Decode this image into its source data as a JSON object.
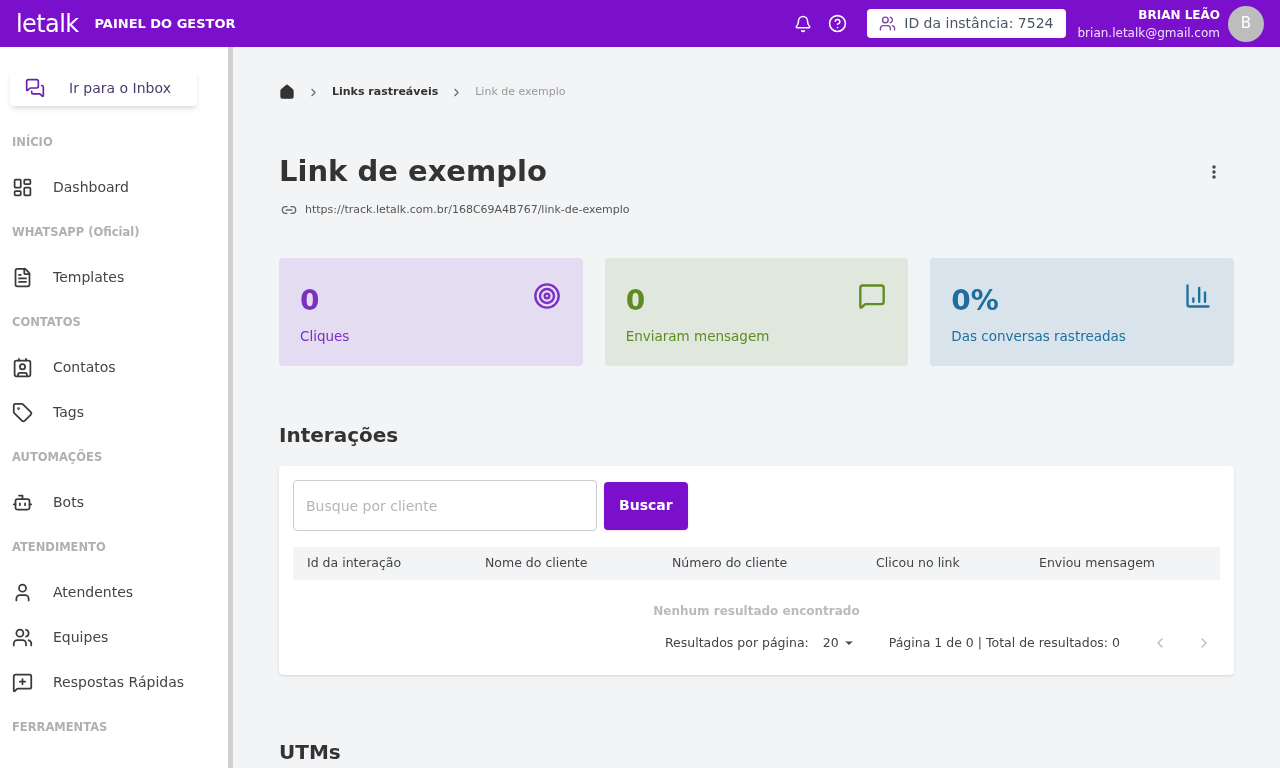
{
  "header": {
    "logo": "letalk",
    "title": "PAINEL DO GESTOR",
    "instance": "ID da instância: 7524",
    "user_name": "BRIAN LEÃO",
    "user_email": "brian.letalk@gmail.com",
    "avatar_initial": "B"
  },
  "sidebar": {
    "inbox_button": "Ir para o Inbox",
    "items": [
      {
        "kind": "section",
        "label": "INÍCIO"
      },
      {
        "kind": "item",
        "label": "Dashboard"
      },
      {
        "kind": "section",
        "label": "WHATSAPP (Oficial)"
      },
      {
        "kind": "item",
        "label": "Templates"
      },
      {
        "kind": "section",
        "label": "CONTATOS"
      },
      {
        "kind": "item",
        "label": "Contatos"
      },
      {
        "kind": "item",
        "label": "Tags"
      },
      {
        "kind": "section",
        "label": "AUTOMAÇÕES"
      },
      {
        "kind": "item",
        "label": "Bots"
      },
      {
        "kind": "section",
        "label": "ATENDIMENTO"
      },
      {
        "kind": "item",
        "label": "Atendentes"
      },
      {
        "kind": "item",
        "label": "Equipes"
      },
      {
        "kind": "item",
        "label": "Respostas Rápidas"
      },
      {
        "kind": "section",
        "label": "FERRAMENTAS"
      }
    ]
  },
  "breadcrumb": [
    "Links rastreáveis",
    "Link de exemplo"
  ],
  "page": {
    "title": "Link de exemplo",
    "url": "https://track.letalk.com.br/168C69A4B767/link-de-exemplo"
  },
  "stats": [
    {
      "value": "0",
      "label": "Cliques",
      "color": "#7b2fc4"
    },
    {
      "value": "0",
      "label": "Enviaram mensagem",
      "color": "#5e8c22"
    },
    {
      "value": "0%",
      "label": "Das conversas rastreadas",
      "color": "#1f6f9e"
    }
  ],
  "interactions": {
    "heading": "Interações",
    "search": {
      "placeholder": "Busque por cliente"
    },
    "search_button": "Buscar",
    "columns": [
      "Id da interação",
      "Nome do cliente",
      "Número do cliente",
      "Clicou no link",
      "Enviou mensagem"
    ],
    "empty": "Nenhum resultado encontrado",
    "per_page_label": "Resultados por página:",
    "per_page": "20",
    "pagination": "Página 1 de 0 | Total de resultados: 0"
  },
  "utms_heading": "UTMs"
}
